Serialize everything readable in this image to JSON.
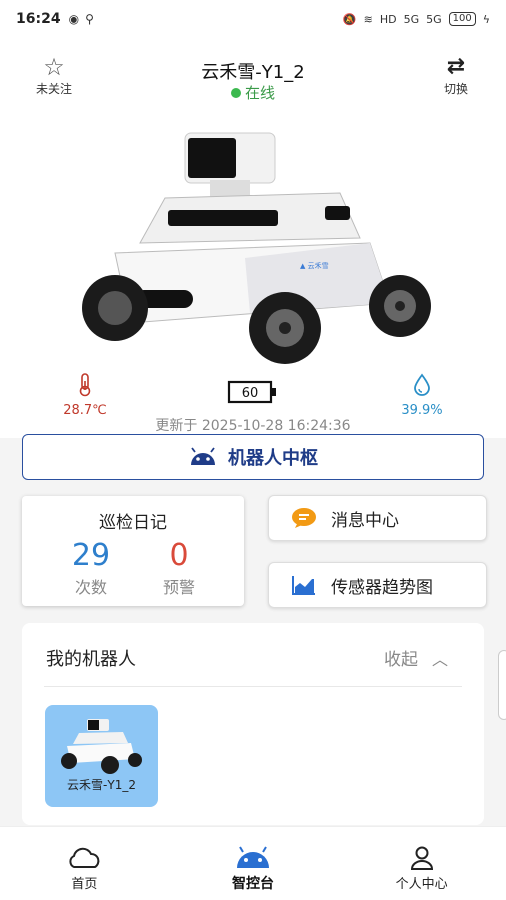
{
  "status_bar": {
    "time": "16:24",
    "network_label": "HD",
    "signal_1": "5G",
    "signal_2": "5G",
    "battery": "100"
  },
  "header": {
    "follow_label": "未关注",
    "switch_label": "切换",
    "robot_name": "云禾雪-Y1_2",
    "status_text": "在线",
    "status_color": "#3cb94f"
  },
  "sensors": {
    "temperature": "28.7℃",
    "battery": "60",
    "humidity": "39.9%",
    "updated": "更新于 2025-10-28 16:24:36"
  },
  "hub_button": {
    "label": "机器人中枢"
  },
  "inspection_log": {
    "title": "巡检日记",
    "count_value": "29",
    "count_label": "次数",
    "alert_value": "0",
    "alert_label": "预警"
  },
  "side_buttons": {
    "messages": "消息中心",
    "sensor_trend": "传感器趋势图"
  },
  "my_robots": {
    "title": "我的机器人",
    "collapse_label": "收起",
    "items": [
      {
        "name": "云禾雪-Y1_2"
      }
    ]
  },
  "tabbar": {
    "tabs": [
      {
        "label": "首页",
        "icon": "cloud-icon"
      },
      {
        "label": "智控台",
        "icon": "android-icon"
      },
      {
        "label": "个人中心",
        "icon": "person-icon"
      }
    ]
  },
  "colors": {
    "accent_blue": "#1f3c88",
    "count_blue": "#2e7fcc",
    "alert_red": "#d94a3a",
    "temp_red": "#c0392b",
    "humidity_blue": "#2a8fc7"
  }
}
